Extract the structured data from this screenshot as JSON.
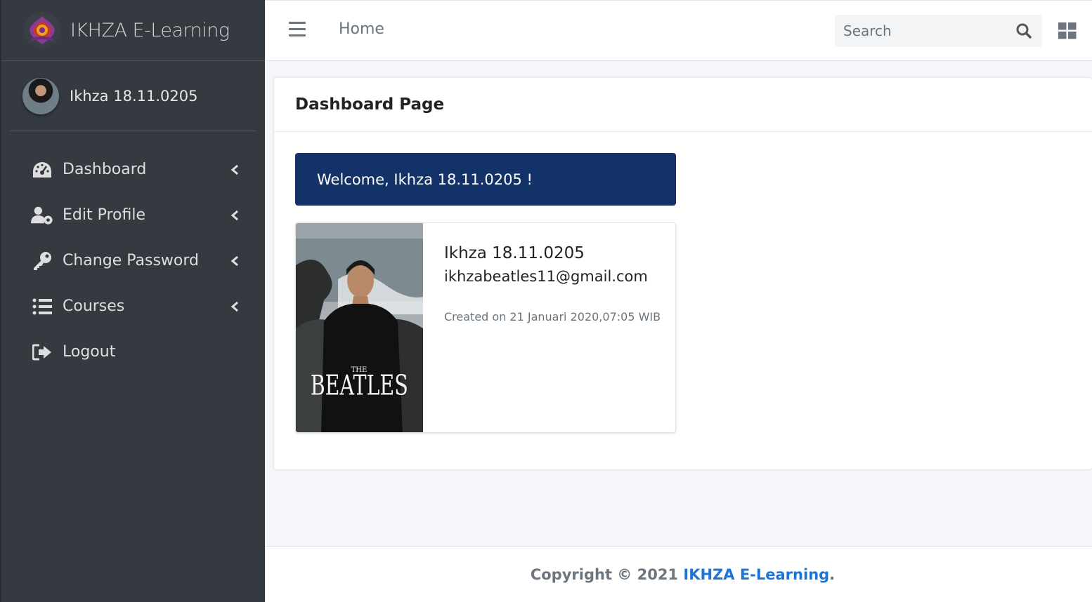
{
  "brand": {
    "name": "IKHZA E-Learning"
  },
  "user": {
    "name": "Ikhza 18.11.0205"
  },
  "sidebar": {
    "items": [
      {
        "label": "Dashboard",
        "icon": "tachometer-icon",
        "has_submenu": true
      },
      {
        "label": "Edit Profile",
        "icon": "user-cog-icon",
        "has_submenu": true
      },
      {
        "label": "Change Password",
        "icon": "key-icon",
        "has_submenu": true
      },
      {
        "label": "Courses",
        "icon": "list-icon",
        "has_submenu": true
      },
      {
        "label": "Logout",
        "icon": "sign-out-icon",
        "has_submenu": false
      }
    ]
  },
  "topbar": {
    "home_label": "Home",
    "search_placeholder": "Search"
  },
  "main": {
    "card_title": "Dashboard Page",
    "welcome": "Welcome, Ikhza 18.11.0205 !",
    "profile": {
      "name": "Ikhza 18.11.0205",
      "email": "ikhzabeatles11@gmail.com",
      "created": "Created on 21 Januari 2020,07:05 WIB"
    }
  },
  "footer": {
    "prefix": "Copyright © 2021 ",
    "link": "IKHZA E-Learning",
    "suffix": "."
  },
  "colors": {
    "sidebar_bg": "#343a40",
    "welcome_bg": "#133268",
    "link": "#1d74d8",
    "page_bg": "#f4f6f9"
  }
}
